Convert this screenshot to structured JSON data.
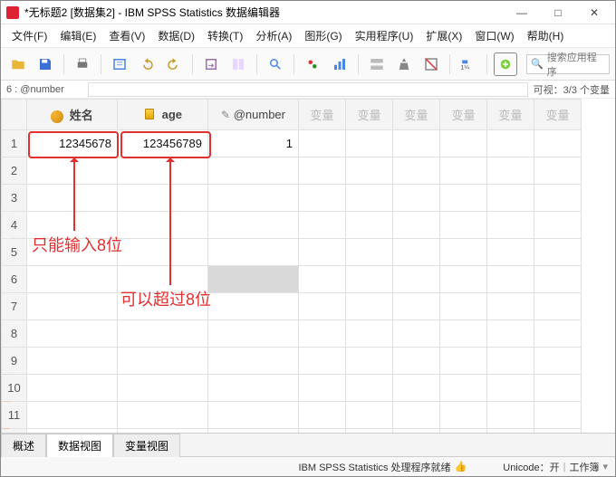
{
  "window": {
    "title": "*无标题2 [数据集2] - IBM SPSS Statistics 数据编辑器",
    "ctrl": {
      "min": "—",
      "max": "□",
      "close": "✕"
    }
  },
  "menu": [
    "文件(F)",
    "编辑(E)",
    "查看(V)",
    "数据(D)",
    "转换(T)",
    "分析(A)",
    "图形(G)",
    "实用程序(U)",
    "扩展(X)",
    "窗口(W)",
    "帮助(H)"
  ],
  "search_placeholder": "搜索应用程序",
  "cellbar": {
    "label": "6 : @number",
    "value": "",
    "visible": "可视：3/3 个变量"
  },
  "columns": {
    "c1": {
      "icon": "nominal",
      "label": "姓名"
    },
    "c2": {
      "icon": "scale",
      "label": "age"
    },
    "c3": {
      "icon": "pencil",
      "label": "@number"
    },
    "empty": "变量"
  },
  "rows": {
    "count": 13,
    "data": {
      "1": {
        "c1": "12345678",
        "c2": "123456789",
        "c3": "1"
      }
    },
    "selected": {
      "row": 6,
      "col": "c3"
    }
  },
  "annotations": {
    "note1": "只能输入8位",
    "note2": "可以超过8位"
  },
  "tabs": {
    "t1": "概述",
    "t2": "数据视图",
    "t3": "变量视图",
    "active": "t2"
  },
  "status": {
    "center": "IBM SPSS Statistics 处理程序就绪",
    "unicode": "Unicode：开",
    "mode": "工作簿"
  }
}
